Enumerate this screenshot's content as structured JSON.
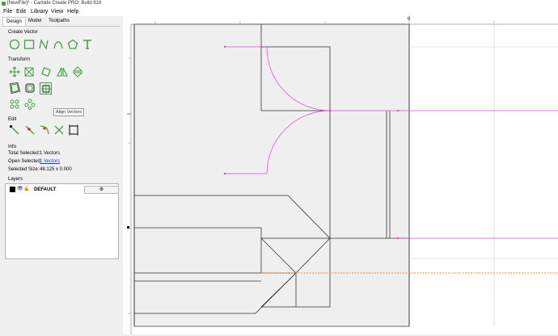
{
  "window": {
    "title": "[NewFile]* - Carbide Create PRO: Build 816"
  },
  "menu": {
    "file": "File",
    "edit": "Edit",
    "library": "Library",
    "view": "View",
    "help": "Help"
  },
  "tabs": {
    "design": "Design",
    "model": "Model",
    "toolpaths": "Toolpaths"
  },
  "sections": {
    "create_vector": "Create Vector",
    "transform": "Transform",
    "edit": "Edit",
    "info": "Info",
    "layers": "Layers"
  },
  "tooltip": "Align Vectors",
  "info": {
    "total_selected_label": "Total Selected:",
    "total_selected_value": "1 Vectors",
    "open_selected_label": "Open Selected:",
    "open_selected_value": "1 Vectors",
    "selected_size_label": "Selected Size:",
    "selected_size_value": "48.125 x 0.000"
  },
  "layers": [
    {
      "name": "DEFAULT"
    }
  ],
  "ruler": {
    "origin_label": "0"
  },
  "colors": {
    "accent_green": "#3fa33f",
    "selection_magenta": "#e040e0",
    "guide_orange": "#ff8c1a"
  }
}
